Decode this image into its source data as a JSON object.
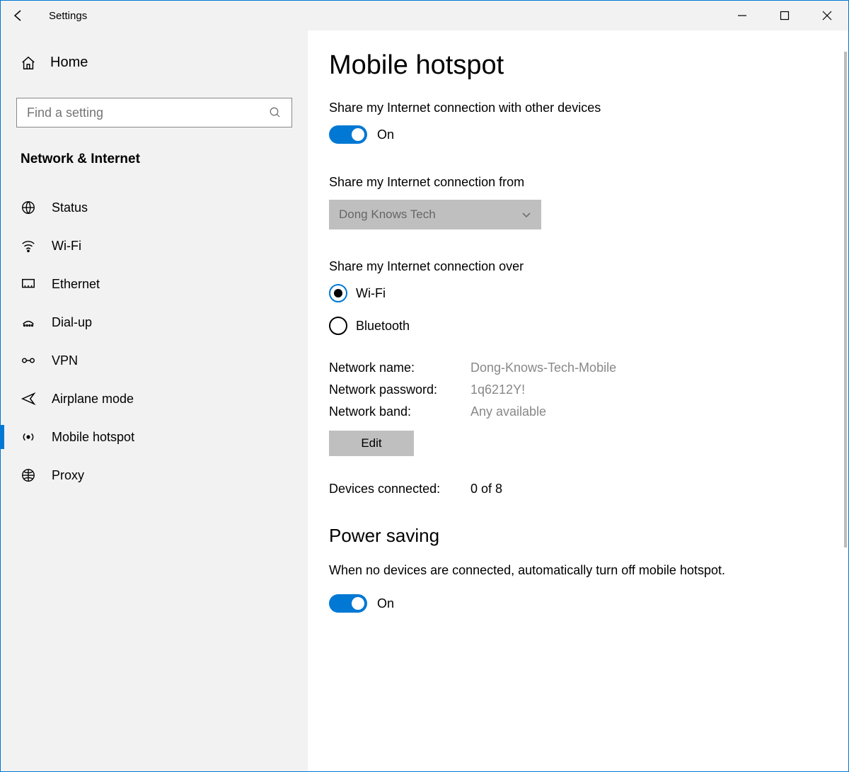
{
  "window": {
    "title": "Settings"
  },
  "sidebar": {
    "home": "Home",
    "search_placeholder": "Find a setting",
    "section": "Network & Internet",
    "items": [
      {
        "label": "Status"
      },
      {
        "label": "Wi-Fi"
      },
      {
        "label": "Ethernet"
      },
      {
        "label": "Dial-up"
      },
      {
        "label": "VPN"
      },
      {
        "label": "Airplane mode"
      },
      {
        "label": "Mobile hotspot"
      },
      {
        "label": "Proxy"
      }
    ]
  },
  "main": {
    "title": "Mobile hotspot",
    "share_label": "Share my Internet connection with other devices",
    "share_toggle_state": "On",
    "from_label": "Share my Internet connection from",
    "from_value": "Dong Knows Tech",
    "over_label": "Share my Internet connection over",
    "radio_wifi": "Wi-Fi",
    "radio_bluetooth": "Bluetooth",
    "net_name_label": "Network name:",
    "net_name_value": "Dong-Knows-Tech-Mobile",
    "net_pass_label": "Network password:",
    "net_pass_value": "1q6212Y!",
    "net_band_label": "Network band:",
    "net_band_value": "Any available",
    "edit": "Edit",
    "devices_label": "Devices connected:",
    "devices_value": "0 of 8",
    "power_heading": "Power saving",
    "power_text": "When no devices are connected, automatically turn off mobile hotspot.",
    "power_toggle_state": "On"
  },
  "colors": {
    "accent": "#0078d4",
    "sidebar_bg": "#f2f2f2",
    "disabled_bg": "#bfbfbf"
  }
}
